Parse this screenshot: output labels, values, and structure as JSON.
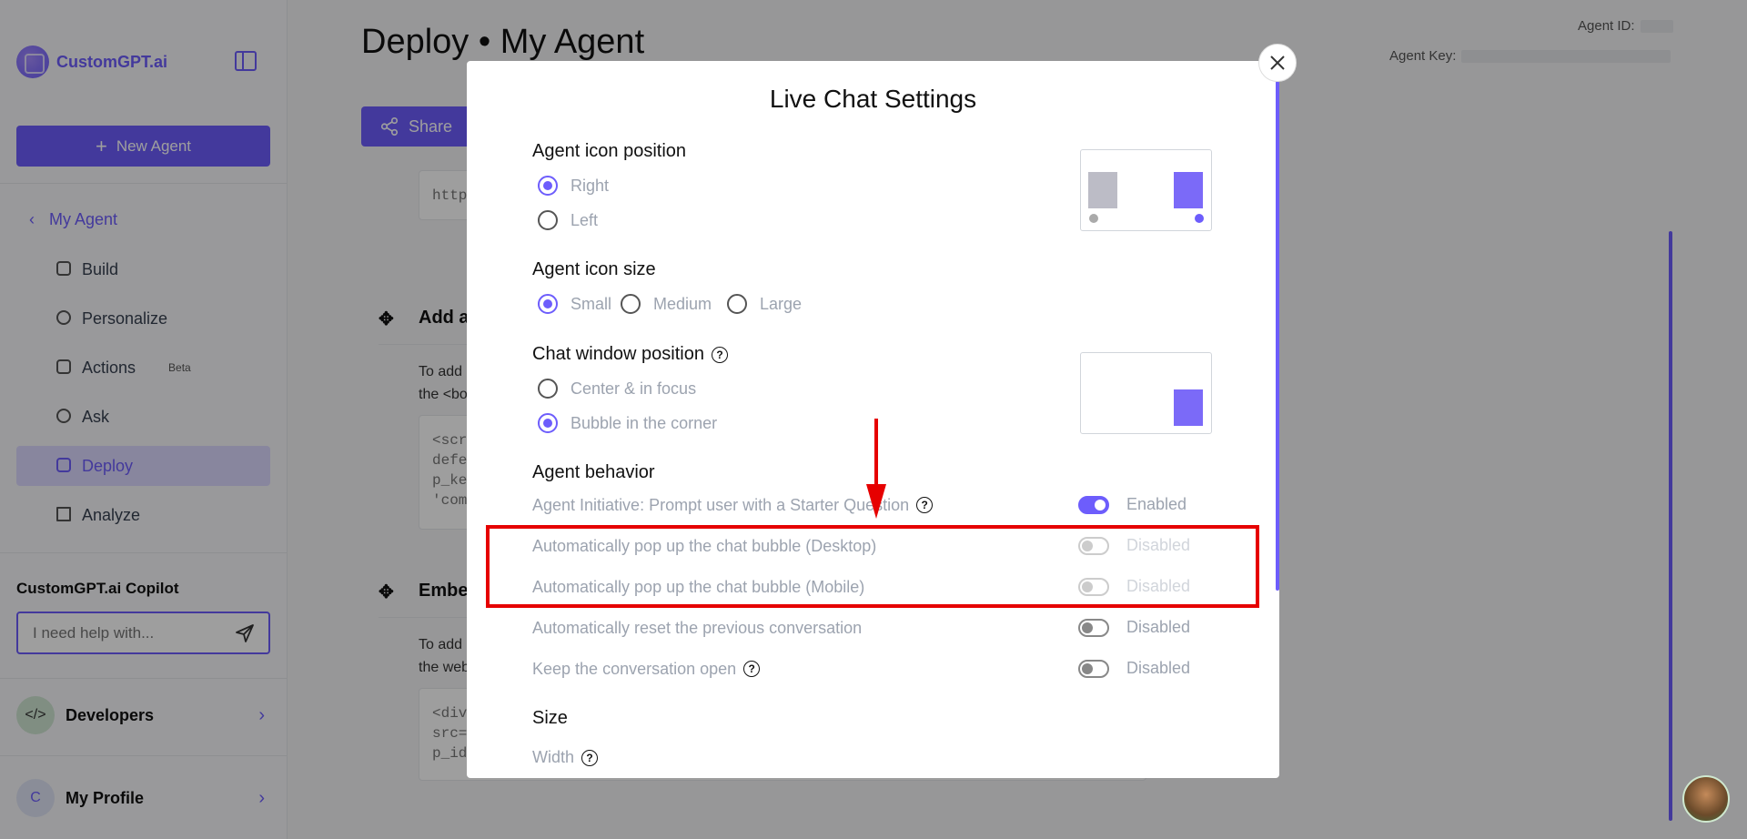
{
  "sidebar": {
    "logo_text": "CustomGPT.ai",
    "new_agent_label": "New Agent",
    "back_label": "My Agent",
    "nav": [
      {
        "label": "Build"
      },
      {
        "label": "Personalize"
      },
      {
        "label": "Actions",
        "badge": "Beta"
      },
      {
        "label": "Ask"
      },
      {
        "label": "Deploy"
      },
      {
        "label": "Analyze"
      }
    ],
    "copilot_title": "CustomGPT.ai Copilot",
    "copilot_placeholder": "I need help with...",
    "developers_label": "Developers",
    "profile_label": "My Profile",
    "profile_initial": "C"
  },
  "main": {
    "title": "Deploy • My Agent",
    "agent_id_label": "Agent ID:",
    "agent_key_label": "Agent Key:",
    "share_label": "Share",
    "bg_url_fragment": "http",
    "add_heading": "Add a",
    "add_desc_1": "To add",
    "add_desc_2": "the <bo",
    "code1": [
      "<scr",
      "defe",
      "p_ke",
      "'com"
    ],
    "embed_heading": "Embe",
    "embed_desc_1": "To add",
    "embed_desc_2": "the web",
    "code2": [
      "<div",
      "src=",
      "p_id"
    ]
  },
  "modal": {
    "title": "Live Chat Settings",
    "icon_position": {
      "title": "Agent icon position",
      "options": [
        "Right",
        "Left"
      ],
      "selected": "Right"
    },
    "icon_size": {
      "title": "Agent icon size",
      "options": [
        "Small",
        "Medium",
        "Large"
      ],
      "selected": "Small"
    },
    "window_position": {
      "title": "Chat window position",
      "options": [
        "Center & in focus",
        "Bubble in the corner"
      ],
      "selected": "Bubble in the corner"
    },
    "behavior": {
      "title": "Agent behavior",
      "rows": [
        {
          "label": "Agent Initiative: Prompt user with a Starter Question",
          "status": "Enabled",
          "on": true,
          "help": true,
          "dim": false
        },
        {
          "label": "Automatically pop up the chat bubble (Desktop)",
          "status": "Disabled",
          "on": false,
          "help": false,
          "dim": true
        },
        {
          "label": "Automatically pop up the chat bubble (Mobile)",
          "status": "Disabled",
          "on": false,
          "help": false,
          "dim": true
        },
        {
          "label": "Automatically reset the previous conversation",
          "status": "Disabled",
          "on": false,
          "help": false,
          "dim": false
        },
        {
          "label": "Keep the conversation open",
          "status": "Disabled",
          "on": false,
          "help": true,
          "dim": false
        }
      ]
    },
    "size": {
      "title": "Size",
      "width_label": "Width"
    }
  },
  "colors": {
    "accent": "#6d5dfc",
    "annotation_red": "#e60000"
  }
}
